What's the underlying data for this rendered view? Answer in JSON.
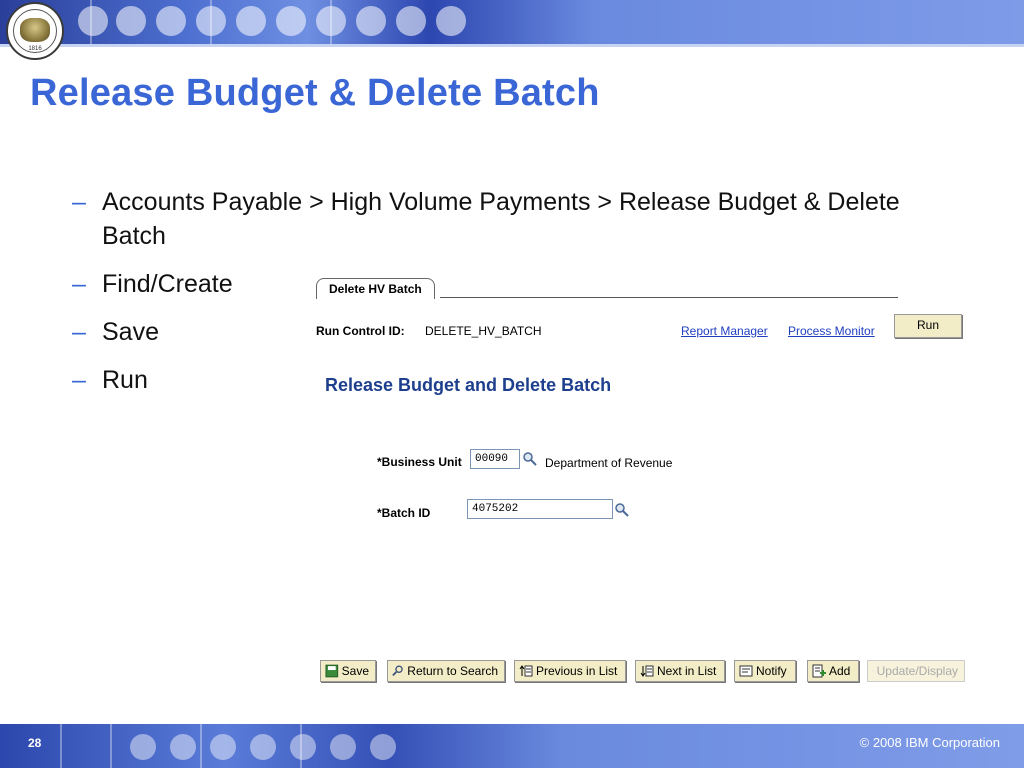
{
  "slide": {
    "title": "Release Budget & Delete Batch",
    "seal_year": "1816",
    "bullets": [
      {
        "text": "Accounts Payable > High Volume Payments > Release Budget & Delete Batch"
      },
      {
        "text": "Find/Create"
      },
      {
        "text": "Save"
      },
      {
        "text": "Run"
      }
    ],
    "page_number": "28",
    "copyright": "© 2008 IBM Corporation"
  },
  "app": {
    "tab_label": "Delete HV Batch",
    "run_control_label": "Run Control ID:",
    "run_control_value": "DELETE_HV_BATCH",
    "links": {
      "report_manager": "Report Manager",
      "process_monitor": "Process Monitor"
    },
    "run_button": "Run",
    "section_title": "Release Budget and Delete Batch",
    "business_unit": {
      "label": "*Business Unit",
      "value": "00090",
      "description": "Department of Revenue"
    },
    "batch_id": {
      "label": "*Batch ID",
      "value": "4075202"
    },
    "toolbar": {
      "save": "Save",
      "return_to_search": "Return to Search",
      "previous_in_list": "Previous in List",
      "next_in_list": "Next in List",
      "notify": "Notify",
      "add": "Add",
      "update_display": "Update/Display"
    },
    "icons": {
      "lookup": "magnifier-icon",
      "save": "save-icon",
      "return": "return-search-icon",
      "previous": "previous-list-icon",
      "next": "next-list-icon",
      "notify": "notify-icon",
      "add": "add-icon",
      "update": "update-display-icon"
    },
    "colors": {
      "title_blue": "#3a66d6",
      "section_blue": "#1e3f8e",
      "link_blue": "#1f3fbf",
      "button_bg": "#f2edc7"
    }
  }
}
